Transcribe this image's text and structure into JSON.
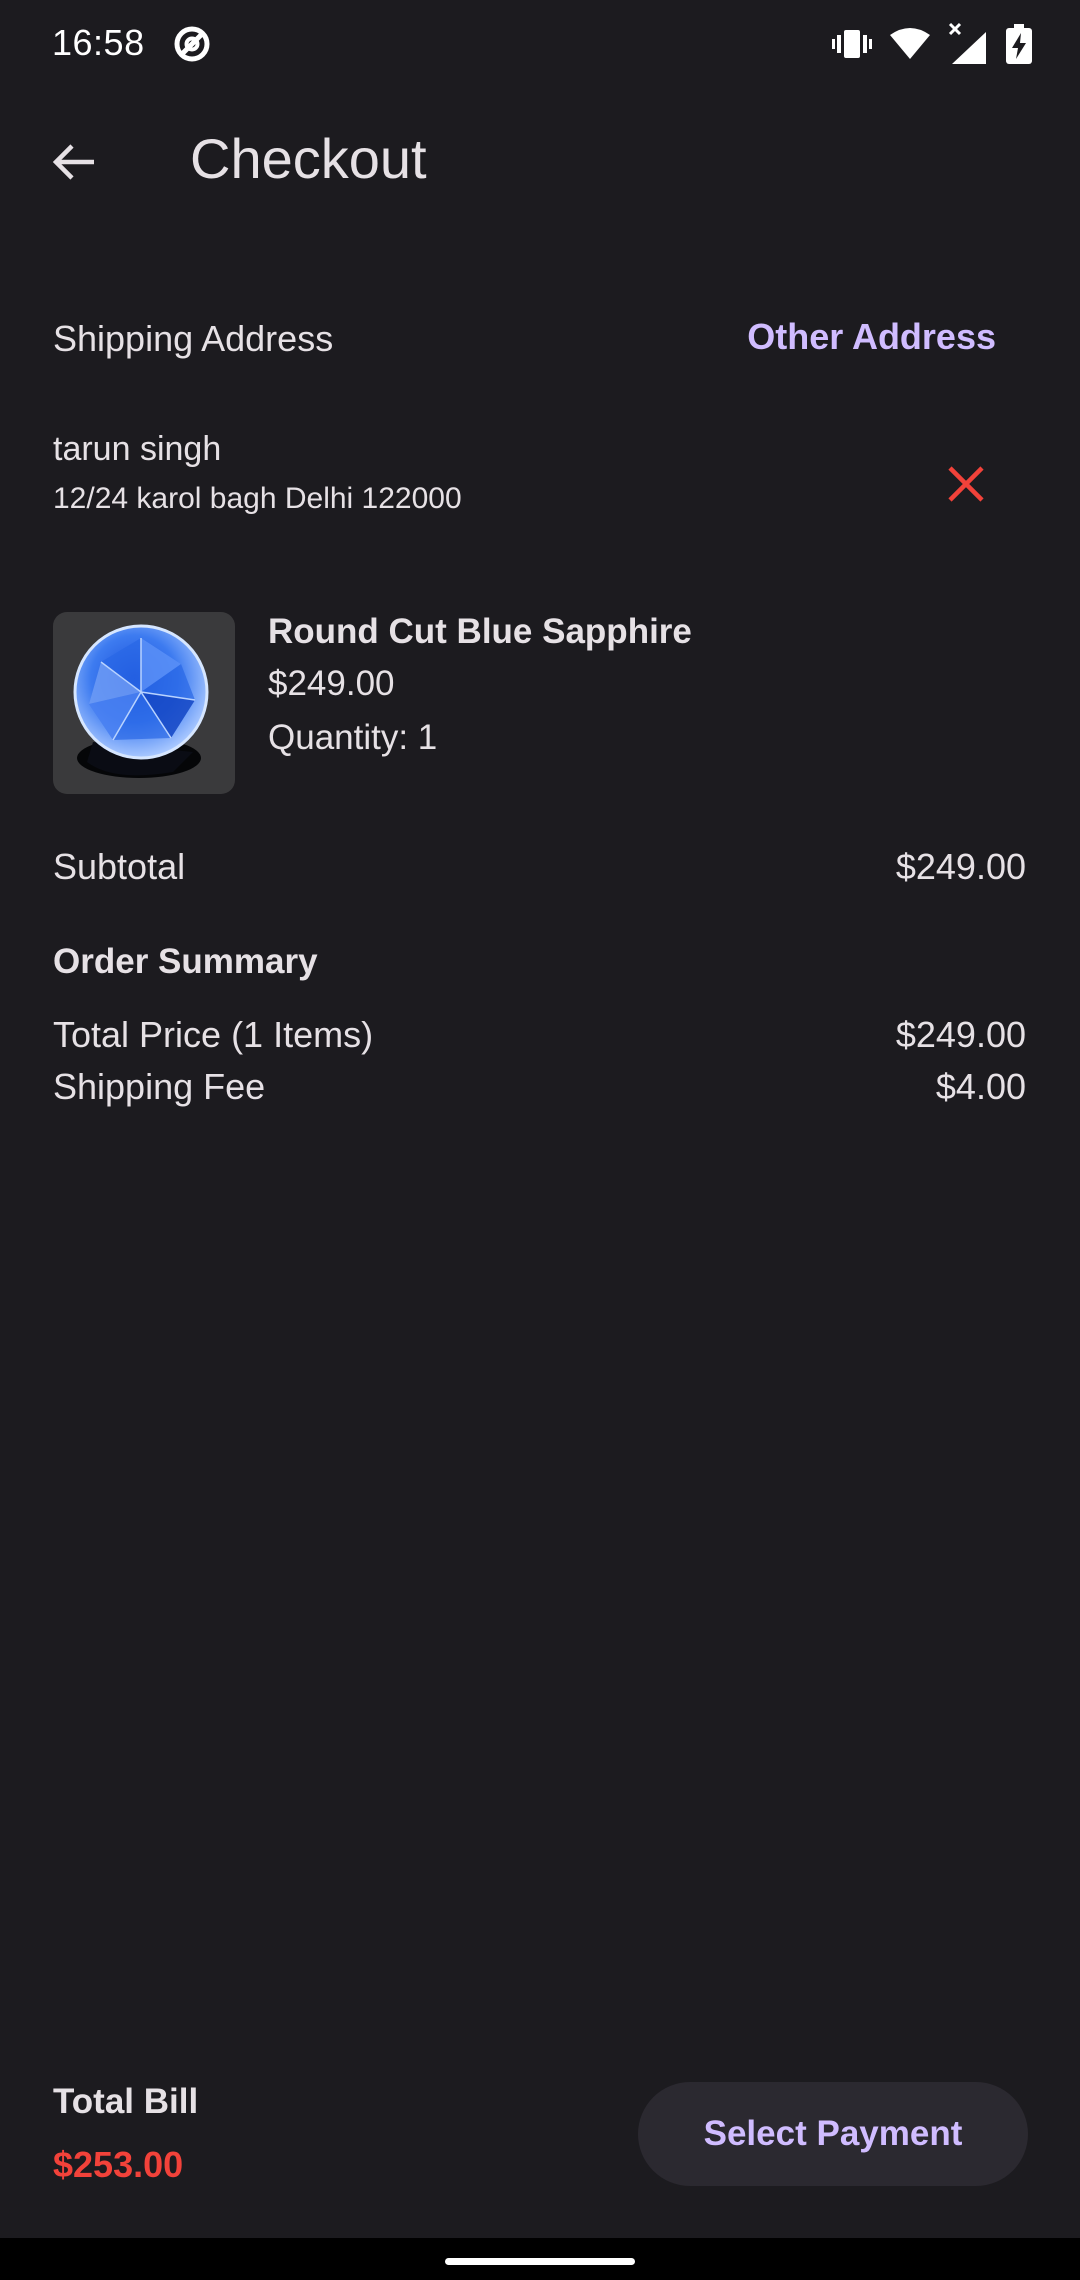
{
  "status_bar": {
    "time": "16:58",
    "icons": [
      "at-sign-icon",
      "vibrate-icon",
      "wifi-icon",
      "signal-icon",
      "battery-charging-icon"
    ]
  },
  "app_bar": {
    "title": "Checkout",
    "back_icon": "arrow-back-icon"
  },
  "shipping": {
    "label": "Shipping Address",
    "other_address_label": "Other Address",
    "name": "tarun singh",
    "address_line": "12/24 karol bagh Delhi 122000",
    "remove_icon": "close-icon"
  },
  "product": {
    "name": "Round Cut Blue Sapphire",
    "price": "$249.00",
    "quantity": "Quantity: 1"
  },
  "subtotal": {
    "label": "Subtotal",
    "value": "$249.00"
  },
  "order_summary": {
    "title": "Order Summary",
    "rows": [
      {
        "label": "Total Price (1 Items)",
        "value": "$249.00"
      },
      {
        "label": "Shipping Fee",
        "value": "$4.00"
      }
    ]
  },
  "footer": {
    "total_label": "Total Bill",
    "total_value": "$253.00",
    "select_payment_label": "Select Payment"
  },
  "colors": {
    "background": "#1c1b1f",
    "accent": "#d0bcff",
    "danger": "#f2423a",
    "button_bg": "#2b2930"
  }
}
